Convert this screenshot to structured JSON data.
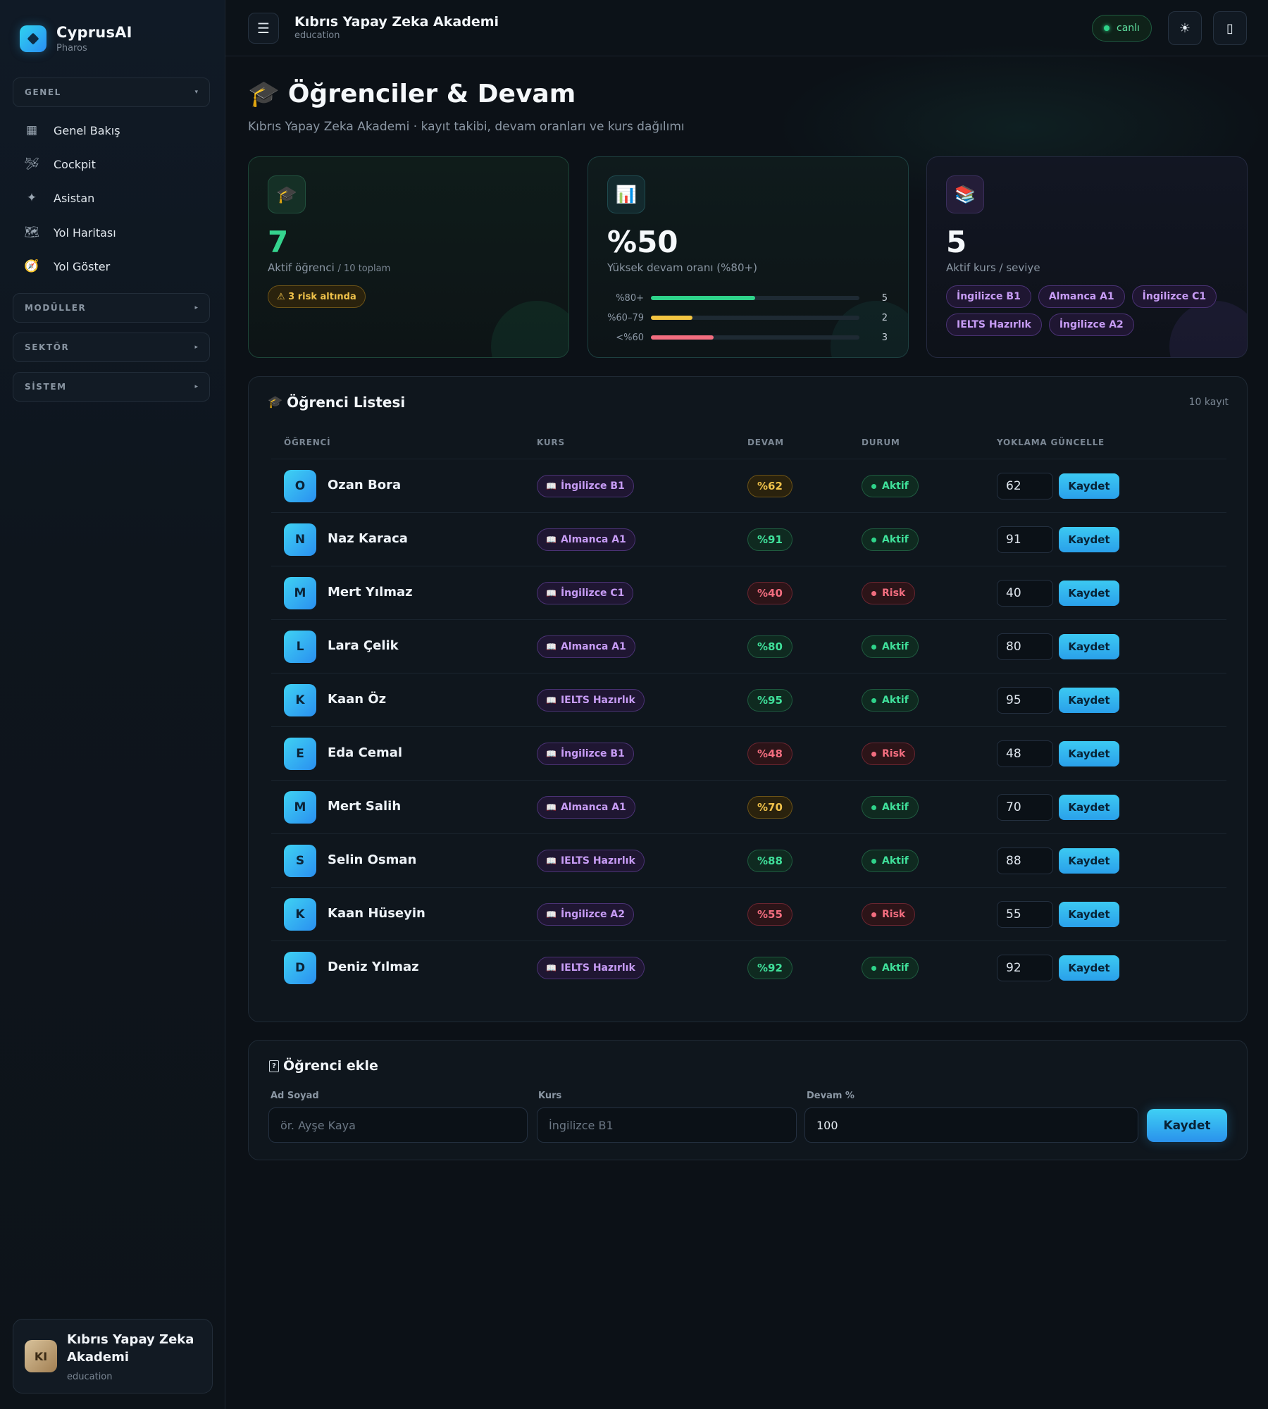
{
  "brand": {
    "name": "CyprusAI",
    "sub": "Pharos"
  },
  "sidebar": {
    "groups": [
      {
        "label": "GENEL",
        "caret": "▾"
      },
      {
        "label": "MODÜLLER",
        "caret": "▸"
      },
      {
        "label": "SEKTÖR",
        "caret": "▸"
      },
      {
        "label": "SİSTEM",
        "caret": "▸"
      }
    ],
    "items": [
      {
        "label": "Genel Bakış",
        "icon": "grid-icon",
        "glyph": "▦"
      },
      {
        "label": "Cockpit",
        "icon": "plane-icon",
        "glyph": "🛩"
      },
      {
        "label": "Asistan",
        "icon": "sparkle-icon",
        "glyph": "✦"
      },
      {
        "label": "Yol Haritası",
        "icon": "map-icon",
        "glyph": "🗺"
      },
      {
        "label": "Yol Göster",
        "icon": "compass-icon",
        "glyph": "🧭"
      }
    ],
    "org": {
      "initials": "KI",
      "name": "Kıbrıs Yapay Zeka Akademi",
      "sub": "education"
    }
  },
  "topbar": {
    "menu_glyph": "☰",
    "title": "Kıbrıs Yapay Zeka Akademi",
    "sub": "education",
    "live": "canlı",
    "theme_glyph": "☀",
    "device_glyph": "▯"
  },
  "page": {
    "icon": "🎓",
    "title": "Öğrenciler & Devam",
    "subtitle": "Kıbrıs Yapay Zeka Akademi · kayıt takibi, devam oranları ve kurs dağılımı"
  },
  "stats": {
    "active": {
      "icon": "🎓",
      "value": "7",
      "label": "Aktif öğrenci",
      "label_small": "/ 10 toplam",
      "risk": "⚠ 3 risk altında"
    },
    "attendance": {
      "icon": "📊",
      "value": "%50",
      "label": "Yüksek devam oranı (%80+)",
      "distribution": [
        {
          "label": "%80+",
          "count": 5,
          "fraction": 0.5,
          "color": "#2fd38a"
        },
        {
          "label": "%60–79",
          "count": 2,
          "fraction": 0.2,
          "color": "#f4c542"
        },
        {
          "label": "<%60",
          "count": 3,
          "fraction": 0.3,
          "color": "#f26d7f"
        }
      ]
    },
    "courses": {
      "icon": "📚",
      "value": "5",
      "label": "Aktif kurs / seviye",
      "chips": [
        "İngilizce B1",
        "Almanca A1",
        "İngilizce C1",
        "IELTS Hazırlık",
        "İngilizce A2"
      ]
    }
  },
  "list": {
    "icon": "🎓",
    "title": "Öğrenci Listesi",
    "count": "10 kayıt",
    "headers": {
      "student": "ÖĞRENCİ",
      "course": "KURS",
      "attendance": "DEVAM",
      "status": "DURUM",
      "update": "YOKLAMA GÜNCELLE"
    },
    "save_label": "Kaydet",
    "rows": [
      {
        "initial": "O",
        "name": "Ozan Bora",
        "course": "İngilizce B1",
        "attendance": "%62",
        "level": "mid",
        "status": "Aktif",
        "state": "ok",
        "input": "62"
      },
      {
        "initial": "N",
        "name": "Naz Karaca",
        "course": "Almanca A1",
        "attendance": "%91",
        "level": "good",
        "status": "Aktif",
        "state": "ok",
        "input": "91"
      },
      {
        "initial": "M",
        "name": "Mert Yılmaz",
        "course": "İngilizce C1",
        "attendance": "%40",
        "level": "bad",
        "status": "Risk",
        "state": "risk",
        "input": "40"
      },
      {
        "initial": "L",
        "name": "Lara Çelik",
        "course": "Almanca A1",
        "attendance": "%80",
        "level": "good",
        "status": "Aktif",
        "state": "ok",
        "input": "80"
      },
      {
        "initial": "K",
        "name": "Kaan Öz",
        "course": "IELTS Hazırlık",
        "attendance": "%95",
        "level": "good",
        "status": "Aktif",
        "state": "ok",
        "input": "95"
      },
      {
        "initial": "E",
        "name": "Eda Cemal",
        "course": "İngilizce B1",
        "attendance": "%48",
        "level": "bad",
        "status": "Risk",
        "state": "risk",
        "input": "48"
      },
      {
        "initial": "M",
        "name": "Mert Salih",
        "course": "Almanca A1",
        "attendance": "%70",
        "level": "mid",
        "status": "Aktif",
        "state": "ok",
        "input": "70"
      },
      {
        "initial": "S",
        "name": "Selin Osman",
        "course": "IELTS Hazırlık",
        "attendance": "%88",
        "level": "good",
        "status": "Aktif",
        "state": "ok",
        "input": "88"
      },
      {
        "initial": "K",
        "name": "Kaan Hüseyin",
        "course": "İngilizce A2",
        "attendance": "%55",
        "level": "bad",
        "status": "Risk",
        "state": "risk",
        "input": "55"
      },
      {
        "initial": "D",
        "name": "Deniz Yılmaz",
        "course": "IELTS Hazırlık",
        "attendance": "%92",
        "level": "good",
        "status": "Aktif",
        "state": "ok",
        "input": "92"
      }
    ]
  },
  "add_form": {
    "title_glyph": "?",
    "title": "Öğrenci ekle",
    "name_label": "Ad Soyad",
    "name_placeholder": "ör. Ayşe Kaya",
    "course_label": "Kurs",
    "course_placeholder": "İngilizce B1",
    "attendance_label": "Devam %",
    "attendance_value": "100",
    "save_label": "Kaydet"
  }
}
